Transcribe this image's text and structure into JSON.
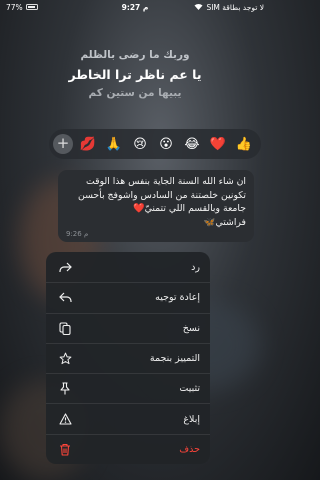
{
  "status_bar": {
    "battery_percent": "77%",
    "time": "9:27 م",
    "carrier": "لا توجد بطاقة SIM"
  },
  "quote": {
    "line1": "وربك ما رضى بالظلم",
    "line2": "يا عم ناظر ترا الخاطر",
    "line3": "يبيها من ستين كم"
  },
  "reactions": [
    "👍",
    "❤️",
    "😂",
    "😮",
    "😢",
    "🙏",
    "💋"
  ],
  "message": {
    "text": "ان شاء الله السنة الجاية بنفس هذا الوقت\nتكونين خلصتنة من السادس واشوفج بأحسن\nجامعة وبالقسم اللي تتمنيّ❤️\nفراشتي🦋",
    "time": "9:26 م"
  },
  "menu": {
    "items": [
      {
        "label": "رد",
        "icon": "reply-icon"
      },
      {
        "label": "إعادة توجيه",
        "icon": "forward-icon"
      },
      {
        "label": "نسخ",
        "icon": "copy-icon"
      },
      {
        "label": "التمييز بنجمة",
        "icon": "star-icon"
      },
      {
        "label": "تثبيت",
        "icon": "pin-icon"
      },
      {
        "label": "إبلاغ",
        "icon": "report-icon"
      },
      {
        "label": "حذف",
        "icon": "trash-icon"
      }
    ]
  },
  "colors": {
    "danger": "#ff453a",
    "menu_bg": "#212428",
    "bubble_bg": "#2b2e32"
  }
}
